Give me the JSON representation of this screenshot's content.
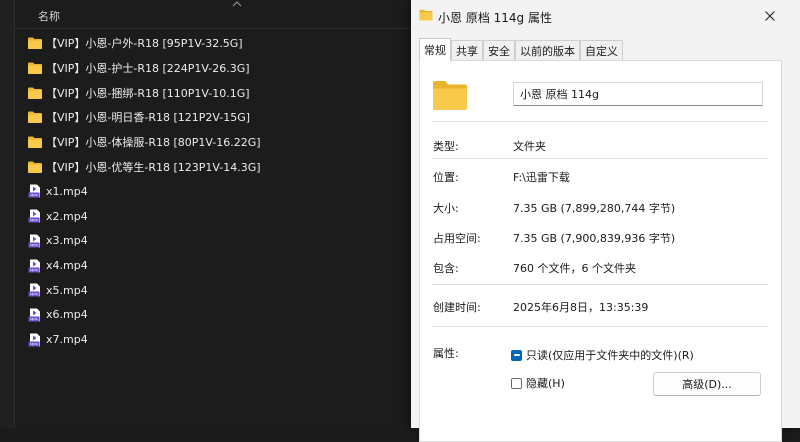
{
  "explorer": {
    "column_header": "名称",
    "folders": [
      {
        "name": "【VIP】小恩-户外-R18 [95P1V-32.5G]",
        "icon": "folder-icon"
      },
      {
        "name": "【VIP】小恩-护士-R18 [224P1V-26.3G]",
        "icon": "folder-icon"
      },
      {
        "name": "【VIP】小恩-捆绑-R18 [110P1V-10.1G]",
        "icon": "folder-icon"
      },
      {
        "name": "【VIP】小恩-明日香-R18 [121P2V-15G]",
        "icon": "folder-icon"
      },
      {
        "name": "【VIP】小恩-体操服-R18 [80P1V-16.22G]",
        "icon": "folder-icon"
      },
      {
        "name": "【VIP】小恩-优等生-R18 [123P1V-14.3G]",
        "icon": "folder-icon"
      }
    ],
    "files": [
      {
        "name": "x1.mp4",
        "icon": "mp4-file-icon"
      },
      {
        "name": "x2.mp4",
        "icon": "mp4-file-icon"
      },
      {
        "name": "x3.mp4",
        "icon": "mp4-file-icon"
      },
      {
        "name": "x4.mp4",
        "icon": "mp4-file-icon"
      },
      {
        "name": "x5.mp4",
        "icon": "mp4-file-icon"
      },
      {
        "name": "x6.mp4",
        "icon": "mp4-file-icon"
      },
      {
        "name": "x7.mp4",
        "icon": "mp4-file-icon"
      }
    ],
    "mp4_badge": "MP4"
  },
  "dialog": {
    "title": "小恩 原档 114g 属性",
    "tabs": [
      "常规",
      "共享",
      "安全",
      "以前的版本",
      "自定义"
    ],
    "active_tab": "常规",
    "folder_name": "小恩 原档 114g",
    "properties": {
      "type_label": "类型:",
      "type_value": "文件夹",
      "location_label": "位置:",
      "location_value": "F:\\迅雷下载",
      "size_label": "大小:",
      "size_value": "7.35 GB (7,899,280,744 字节)",
      "size_on_disk_label": "占用空间:",
      "size_on_disk_value": "7.35 GB (7,900,839,936 字节)",
      "contains_label": "包含:",
      "contains_value": "760 个文件，6 个文件夹",
      "created_label": "创建时间:",
      "created_value": "2025年6月8日，13:35:39",
      "attributes_label": "属性:",
      "readonly_label": "只读(仅应用于文件夹中的文件)(R)",
      "hidden_label": "隐藏(H)",
      "advanced_button": "高级(D)..."
    }
  },
  "colors": {
    "folder_yellow": "#f4c441",
    "accent": "#0067c0",
    "mp4_purple": "#6a4bd4"
  }
}
